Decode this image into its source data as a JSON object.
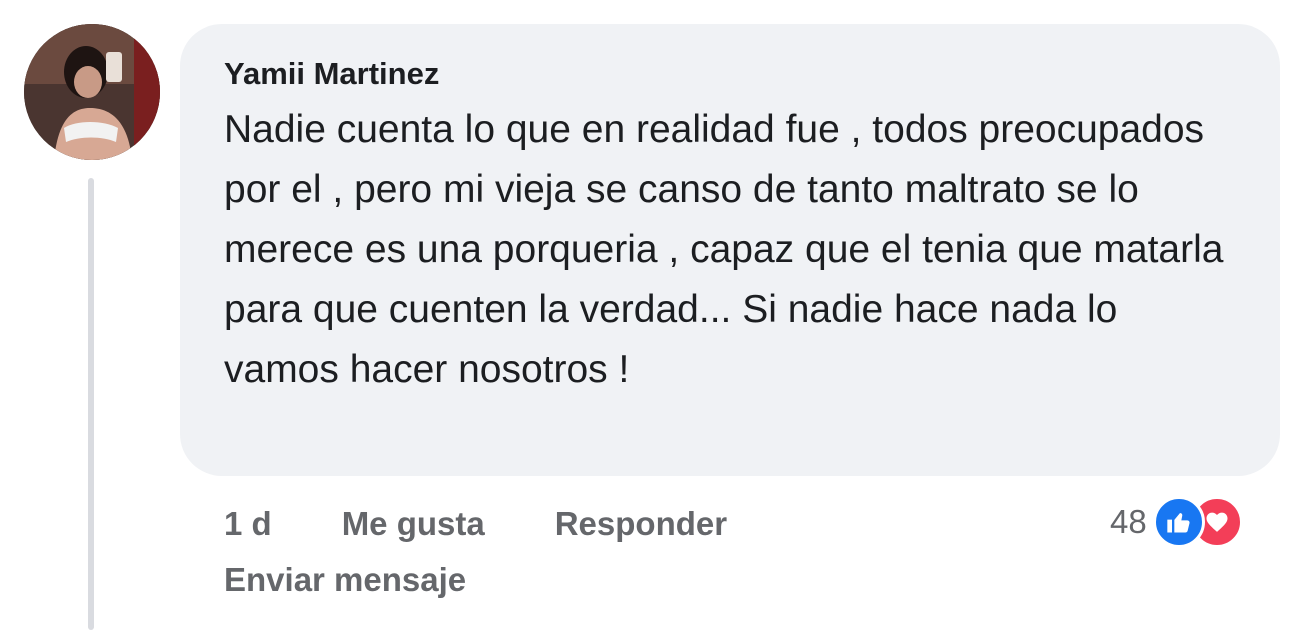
{
  "comment": {
    "author": "Yamii Martinez",
    "text": "Nadie cuenta lo que en realidad fue , todos preocupados por el , pero mi vieja se canso de tanto maltrato se lo merece es una porqueria , capaz que el tenia que matarla para que cuenten la verdad... Si nadie hace nada lo vamos hacer nosotros !",
    "avatar_icon": "profile-photo"
  },
  "actions": {
    "time": "1 d",
    "like_label": "Me gusta",
    "reply_label": "Responder",
    "send_message_label": "Enviar mensaje"
  },
  "reactions": {
    "count": "48",
    "types": [
      "like-icon",
      "love-icon"
    ],
    "colors": {
      "like": "#1877f2",
      "love": "#f33e58"
    }
  },
  "colors": {
    "bubble": "#f0f2f5",
    "secondary_text": "#65676b",
    "thread_line": "#d9dbe0"
  }
}
